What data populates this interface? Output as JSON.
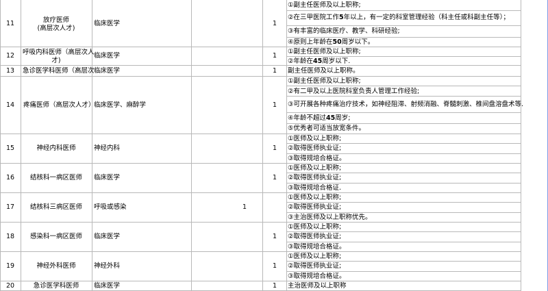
{
  "rows": [
    {
      "no": "11",
      "position": "放疗医师",
      "position2": "(高层次人才)",
      "major": "临床医学",
      "count": "1",
      "reqs": [
        "①副主任医师及以上职称;",
        "②在三甲医院工作5年以上，有一定的科室管理经验（科主任或科副主任等）；",
        "③有丰富的临床医疗、教学、科研经验;",
        "④原则上年龄在50周岁以下。"
      ]
    },
    {
      "no": "12",
      "position": "呼吸内科医师（高层次人",
      "position2": "才)",
      "major": "临床医学",
      "count": "1",
      "reqs": [
        "①副主任医师及以上职称;",
        "②年龄在45周岁以下."
      ]
    },
    {
      "no": "13",
      "position": "急诊医学科医师（高层次",
      "major": "临床医学",
      "count": "1",
      "reqs": [
        "副主任医师及以上职称。"
      ]
    },
    {
      "no": "14",
      "position": "疼痛医师（高层次人才）",
      "major": "临床医学、麻醉学",
      "count": "1",
      "reqs": [
        "①副主任医师及以上职称;",
        "②有二甲及以上医院科室负责人管理工作经验;",
        "③可开展各种疼痛治疗技术，如神经阻滞、射频消融、脊髓刺激、椎间盘溶盘术等.",
        "④年龄不超过45周岁;",
        "⑤优秀者可适当放宽条件。"
      ]
    },
    {
      "no": "15",
      "position": "神经内科医师",
      "major": "神经内科",
      "count": "1",
      "reqs": [
        "①医师及以上职称;",
        "②取得医师执业证;",
        "③取得规培合格证。"
      ]
    },
    {
      "no": "16",
      "position": "结核科一病区医师",
      "major": "临床医学",
      "count": "1",
      "reqs": [
        "①医师及以上职称;",
        "②取得医师执业证;",
        "③取得规培合格证."
      ]
    },
    {
      "no": "17",
      "position": "结核科三病区医师",
      "major": "呼吸或感染",
      "count": "1",
      "reqs": [
        "①医师及以上职称;",
        "②取得医师执业证;",
        "③主治医师及以上职称优先。"
      ]
    },
    {
      "no": "18",
      "position": "感染科一病区医师",
      "major": "临床医学",
      "count": "1",
      "reqs": [
        "①医师及以上职称;",
        "②取得医师执业证;",
        "③取得规培合格证。"
      ]
    },
    {
      "no": "19",
      "position": "神经外科医师",
      "major": "神经外科",
      "count": "1",
      "reqs": [
        "①医师及以上职称;",
        "②取得医师执业证;",
        "③取得规培合格证。"
      ]
    },
    {
      "no": "20",
      "position": "急诊医学科医师",
      "major": "临床医学",
      "count": "1",
      "reqs": [
        "主治医师及以上职称"
      ]
    }
  ]
}
